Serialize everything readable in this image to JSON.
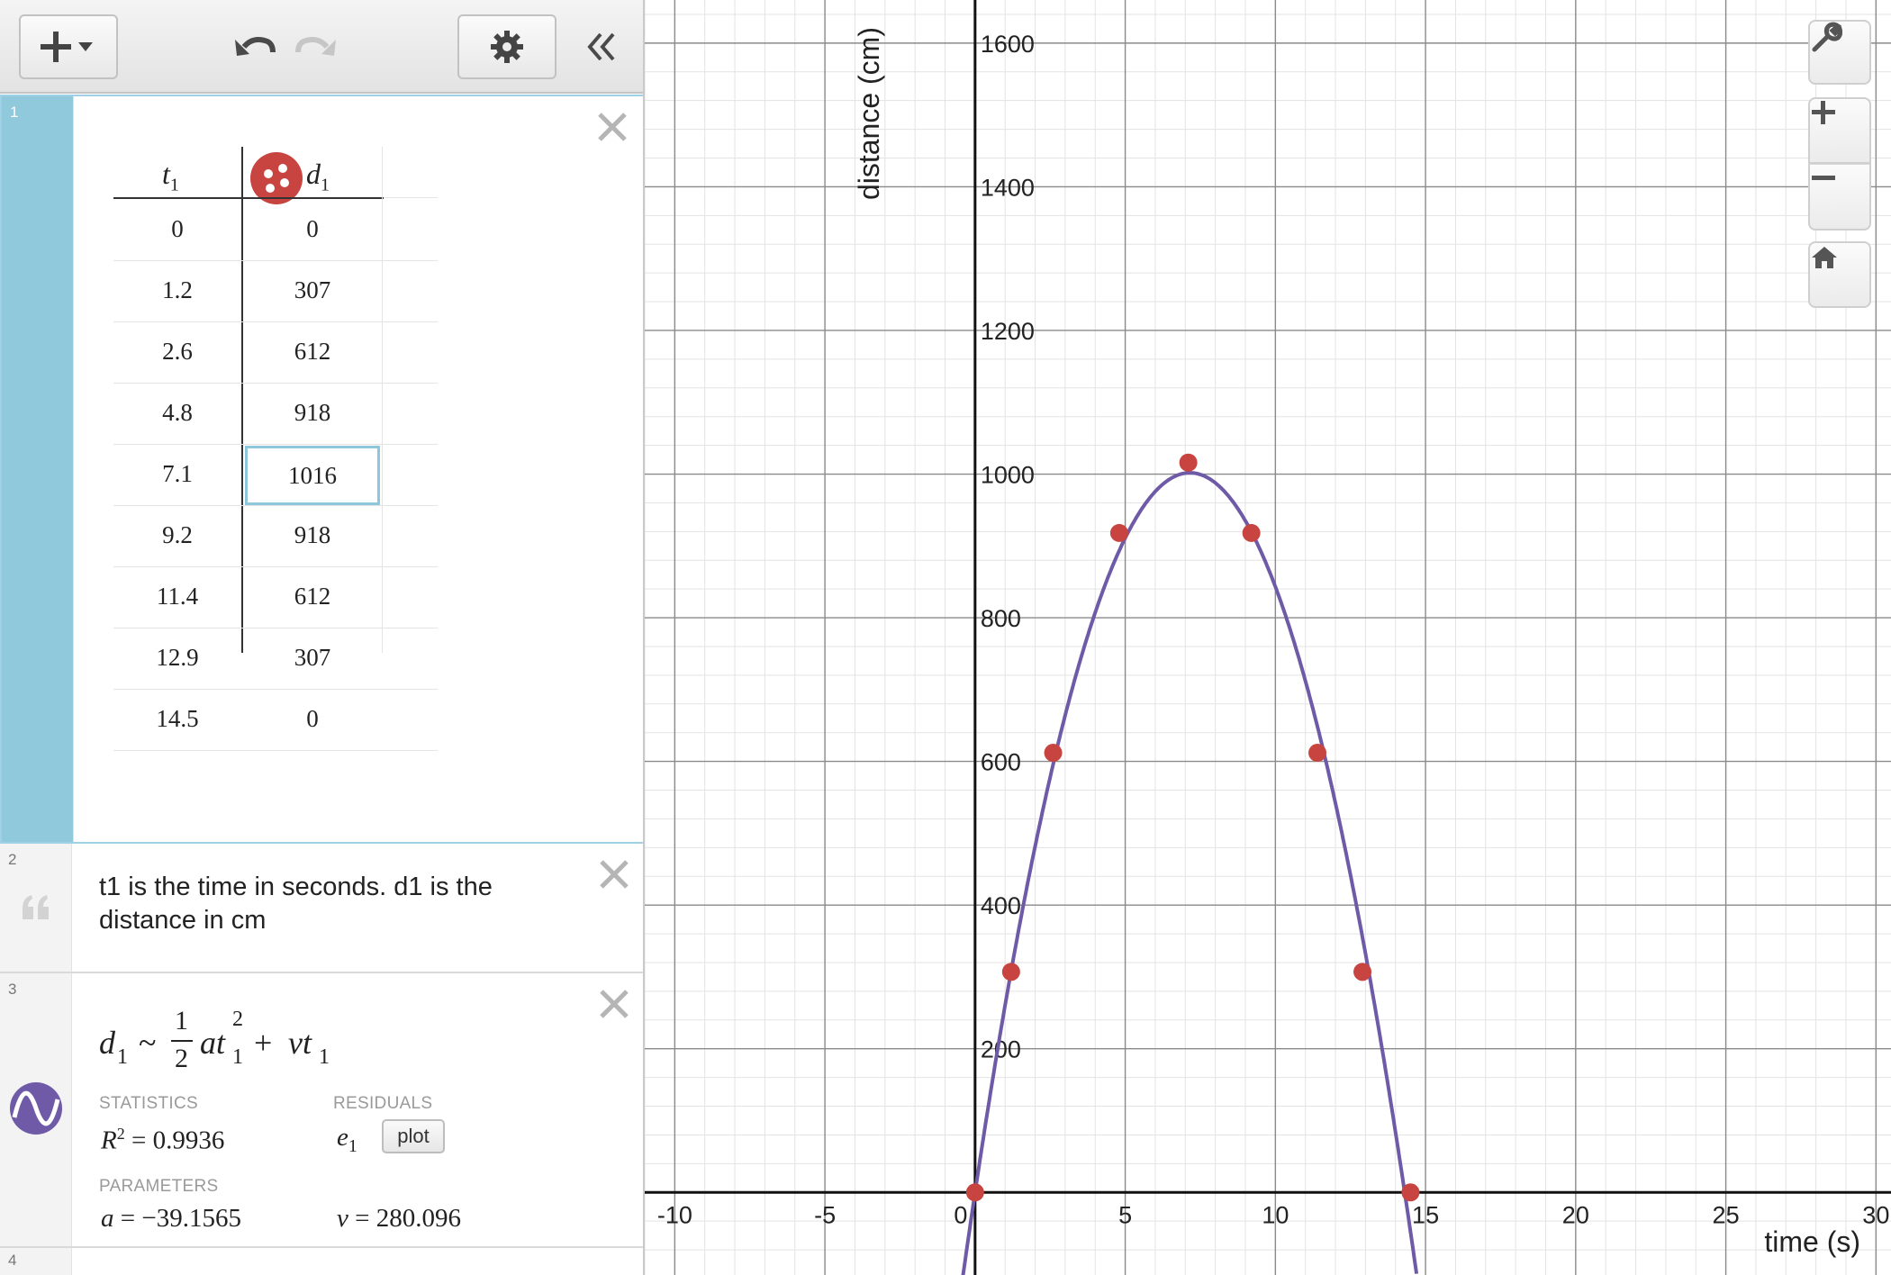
{
  "toolbar": {
    "add_icon": "plus-with-caret-icon",
    "undo_icon": "undo-icon",
    "redo_icon": "redo-icon",
    "settings_icon": "gear-icon",
    "collapse_icon": "double-chevron-left-icon"
  },
  "expressions": {
    "table": {
      "index": "1",
      "col1_var": "t",
      "col1_sub": "1",
      "col2_var": "d",
      "col2_sub": "1",
      "point_color": "#c74440",
      "rows": [
        {
          "t": "0",
          "d": "0"
        },
        {
          "t": "1.2",
          "d": "307"
        },
        {
          "t": "2.6",
          "d": "612"
        },
        {
          "t": "4.8",
          "d": "918"
        },
        {
          "t": "7.1",
          "d": "1016"
        },
        {
          "t": "9.2",
          "d": "918"
        },
        {
          "t": "11.4",
          "d": "612"
        },
        {
          "t": "12.9",
          "d": "307"
        },
        {
          "t": "14.5",
          "d": "0"
        }
      ],
      "selected_row": 4
    },
    "note": {
      "index": "2",
      "text": "t1 is the time in seconds. d1 is the distance in cm"
    },
    "regression": {
      "index": "3",
      "curve_color": "#6f5aa8",
      "statistics_label": "STATISTICS",
      "residuals_label": "RESIDUALS",
      "parameters_label": "PARAMETERS",
      "r2": "0.9936",
      "residual_var": "e",
      "residual_sub": "1",
      "plot_label": "plot",
      "a_value": "−39.1565",
      "v_value": "280.096"
    },
    "empty": {
      "index": "4"
    }
  },
  "graph": {
    "grid_minor_color": "#e3e3e3",
    "grid_major_color": "#8a8a8a"
  },
  "chart_data": {
    "type": "scatter",
    "xlabel": "time (s)",
    "ylabel": "distance (cm)",
    "xlim": [
      -11,
      30.5
    ],
    "ylim": [
      -115,
      1660
    ],
    "x_ticks": [
      -10,
      -5,
      0,
      5,
      10,
      15,
      20,
      25,
      30
    ],
    "y_ticks": [
      200,
      400,
      600,
      800,
      1000,
      1200,
      1400,
      1600
    ],
    "grid": true,
    "series": [
      {
        "name": "",
        "kind": "points",
        "color": "#c74440",
        "x": [
          0,
          1.2,
          2.6,
          4.8,
          7.1,
          9.2,
          11.4,
          12.9,
          14.5
        ],
        "y": [
          0,
          307,
          612,
          918,
          1016,
          918,
          612,
          307,
          0
        ]
      },
      {
        "name": "",
        "kind": "fit",
        "color": "#6f5aa8",
        "a": -39.1565,
        "v": 280.096
      }
    ]
  },
  "graph_controls": {
    "wrench_icon": "wrench-icon",
    "zoom_in_icon": "plus-icon",
    "zoom_out_icon": "minus-icon",
    "home_icon": "home-icon"
  }
}
